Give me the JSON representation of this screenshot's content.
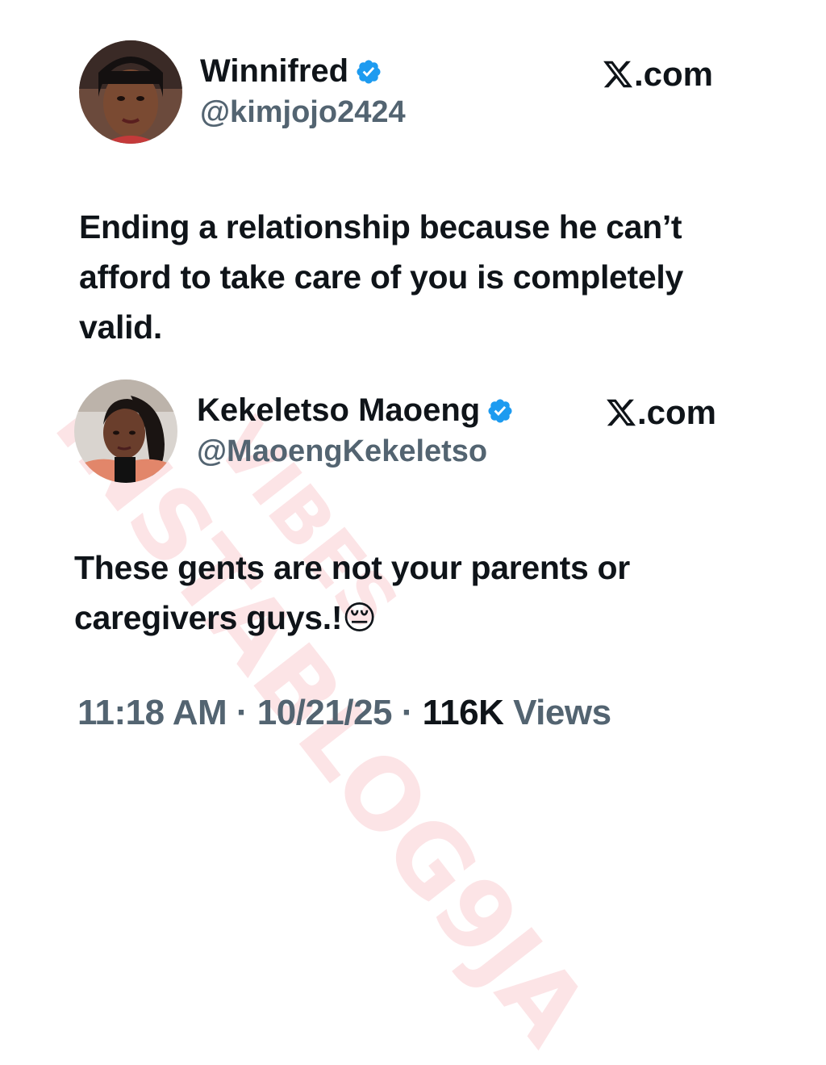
{
  "tweet1": {
    "display_name": "Winnifred",
    "handle": "@kimjojo2424",
    "brand": ".com",
    "verified_icon": "verified-badge-icon",
    "text": "Ending a relationship because he can’t afford to take care of you is completely valid."
  },
  "tweet2": {
    "display_name": "Kekeletso Maoeng",
    "handle": "@MaoengKekeletso",
    "brand": ".com",
    "verified_icon": "verified-badge-icon",
    "text": "These gents are not your parents or caregivers guys.!😔"
  },
  "meta": {
    "time": "11:18 AM",
    "sep1": " · ",
    "date": "10/21/25",
    "sep2": " · ",
    "views_count": "116K",
    "views_label": " Views"
  },
  "watermark": {
    "line1": "INSTABLOG9JA",
    "line2": "VIBES"
  },
  "colors": {
    "text": "#0f1419",
    "secondary": "#536471",
    "verified": "#1d9bf0",
    "watermark": "#eb5a64"
  }
}
